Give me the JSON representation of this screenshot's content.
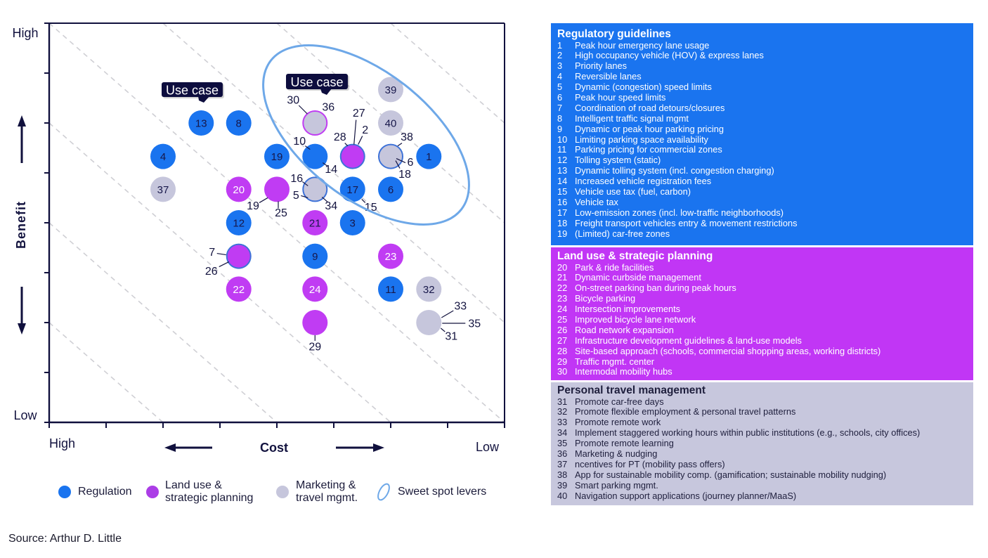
{
  "colors": {
    "regulation": "#1a74ef",
    "land_use": "#c03cf3",
    "marketing": "#c6c6dc",
    "sweet_spot": "#6ea8e8",
    "ink": "#13133f",
    "callout": "#0d0d3e"
  },
  "chart_data": {
    "type": "scatter",
    "title": "",
    "xlabel": "Cost",
    "ylabel": "Benefit",
    "x_end_labels": {
      "left": "High",
      "right": "Low"
    },
    "y_end_labels": {
      "top": "High",
      "bottom": "Low"
    },
    "xlim": [
      0,
      8
    ],
    "ylim": [
      0,
      8
    ],
    "x_ticks": 8,
    "y_ticks": 8,
    "grid": "diagonal dashed iso-lines (cost + benefit = constant)",
    "legend_position": "bottom",
    "points": [
      {
        "id": "13",
        "label": "13",
        "x": 2.67,
        "y": 6.0,
        "fill": "regulation",
        "text": "dark",
        "outer_labels": []
      },
      {
        "id": "8",
        "label": "8",
        "x": 3.33,
        "y": 6.0,
        "fill": "regulation",
        "text": "dark",
        "outer_labels": []
      },
      {
        "id": "4",
        "label": "4",
        "x": 2.0,
        "y": 5.33,
        "fill": "regulation",
        "text": "dark",
        "outer_labels": []
      },
      {
        "id": "37",
        "label": "37",
        "x": 2.0,
        "y": 4.67,
        "fill": "marketing",
        "text": "dark",
        "outer_labels": []
      },
      {
        "id": "20",
        "label": "20",
        "x": 3.33,
        "y": 4.67,
        "fill": "land_use",
        "text": "light",
        "outer_labels": []
      },
      {
        "id": "12",
        "label": "12",
        "x": 3.33,
        "y": 4.0,
        "fill": "regulation",
        "text": "dark",
        "outer_labels": []
      },
      {
        "id": "7/26",
        "label": "",
        "x": 3.33,
        "y": 3.33,
        "fill": "land_use",
        "outline": "regulation",
        "text": "dark",
        "outer_labels": [
          "7",
          "26"
        ]
      },
      {
        "id": "22",
        "label": "22",
        "x": 3.33,
        "y": 2.67,
        "fill": "land_use",
        "text": "light",
        "outer_labels": []
      },
      {
        "id": "19",
        "label": "19",
        "x": 4.0,
        "y": 5.33,
        "fill": "regulation",
        "text": "dark",
        "outer_labels": []
      },
      {
        "id": "19/25",
        "label": "",
        "x": 4.0,
        "y": 4.67,
        "fill": "land_use",
        "text": "dark",
        "outer_labels": [
          "19",
          "25"
        ]
      },
      {
        "id": "30/36",
        "label": "",
        "x": 4.67,
        "y": 6.0,
        "fill": "marketing",
        "outline": "land_use",
        "text": "dark",
        "outer_labels": [
          "30",
          "36"
        ]
      },
      {
        "id": "10/14",
        "label": "",
        "x": 4.67,
        "y": 5.33,
        "fill": "regulation",
        "text": "dark",
        "outer_labels": [
          "10",
          "14"
        ]
      },
      {
        "id": "16/5/34",
        "label": "",
        "x": 4.67,
        "y": 4.67,
        "fill": "marketing",
        "outline": "regulation",
        "text": "dark",
        "outer_labels": [
          "16",
          "5",
          "34"
        ]
      },
      {
        "id": "21",
        "label": "21",
        "x": 4.67,
        "y": 4.0,
        "fill": "land_use",
        "text": "dark",
        "outer_labels": []
      },
      {
        "id": "9",
        "label": "9",
        "x": 4.67,
        "y": 3.33,
        "fill": "regulation",
        "text": "dark",
        "outer_labels": []
      },
      {
        "id": "24",
        "label": "24",
        "x": 4.67,
        "y": 2.67,
        "fill": "land_use",
        "text": "light",
        "outer_labels": []
      },
      {
        "id": "29",
        "label": "",
        "x": 4.67,
        "y": 2.0,
        "fill": "land_use",
        "text": "dark",
        "outer_labels": [
          "29"
        ]
      },
      {
        "id": "28/27/2",
        "label": "",
        "x": 5.33,
        "y": 5.33,
        "fill": "land_use",
        "outline": "regulation",
        "text": "dark",
        "outer_labels": [
          "28",
          "27",
          "2"
        ]
      },
      {
        "id": "17",
        "label": "17",
        "x": 5.33,
        "y": 4.67,
        "fill": "regulation",
        "text": "dark",
        "outer_labels": [
          "15"
        ]
      },
      {
        "id": "3",
        "label": "3",
        "x": 5.33,
        "y": 4.0,
        "fill": "regulation",
        "text": "dark",
        "outer_labels": []
      },
      {
        "id": "39",
        "label": "39",
        "x": 6.0,
        "y": 6.67,
        "fill": "marketing",
        "text": "dark",
        "outer_labels": []
      },
      {
        "id": "40",
        "label": "40",
        "x": 6.0,
        "y": 6.0,
        "fill": "marketing",
        "text": "dark",
        "outer_labels": []
      },
      {
        "id": "38/6/18",
        "label": "",
        "x": 6.0,
        "y": 5.33,
        "fill": "marketing",
        "outline": "regulation",
        "text": "dark",
        "outer_labels": [
          "38",
          "6",
          "18"
        ]
      },
      {
        "id": "6",
        "label": "6",
        "x": 6.0,
        "y": 4.67,
        "fill": "regulation",
        "text": "dark",
        "outer_labels": []
      },
      {
        "id": "23",
        "label": "23",
        "x": 6.0,
        "y": 3.33,
        "fill": "land_use",
        "text": "light",
        "outer_labels": []
      },
      {
        "id": "11",
        "label": "11",
        "x": 6.0,
        "y": 2.67,
        "fill": "regulation",
        "text": "dark",
        "outer_labels": []
      },
      {
        "id": "1",
        "label": "1",
        "x": 6.67,
        "y": 5.33,
        "fill": "regulation",
        "text": "dark",
        "outer_labels": []
      },
      {
        "id": "32",
        "label": "32",
        "x": 6.67,
        "y": 2.67,
        "fill": "marketing",
        "text": "dark",
        "outer_labels": []
      },
      {
        "id": "33/35/31",
        "label": "",
        "x": 6.67,
        "y": 2.0,
        "fill": "marketing",
        "text": "dark",
        "outer_labels": [
          "33",
          "35",
          "31"
        ]
      }
    ],
    "callouts": [
      {
        "text": "Use case",
        "points_to": "13"
      },
      {
        "text": "Use case",
        "points_to": "30/36"
      }
    ],
    "sweet_spot": {
      "label": "Sweet spot levers",
      "members": [
        "39",
        "40",
        "30/36",
        "10/14",
        "28/27/2",
        "38/6/18",
        "1",
        "17",
        "6",
        "16/5/34"
      ]
    }
  },
  "legend": {
    "items": [
      {
        "key": "regulation",
        "line1": "Regulation",
        "line2": ""
      },
      {
        "key": "land_use",
        "line1": "Land use &",
        "line2": "strategic planning"
      },
      {
        "key": "marketing",
        "line1": "Marketing &",
        "line2": "travel mgmt."
      },
      {
        "key": "sweet_spot",
        "line1": "Sweet spot levers",
        "line2": ""
      }
    ]
  },
  "panels": [
    {
      "title": "Regulatory guidelines",
      "items": [
        {
          "n": "1",
          "text": "Peak hour emergency lane usage"
        },
        {
          "n": "2",
          "text": "High occupancy vehicle (HOV) & express lanes"
        },
        {
          "n": "3",
          "text": "Priority lanes"
        },
        {
          "n": "4",
          "text": "Reversible lanes"
        },
        {
          "n": "5",
          "text": "Dynamic (congestion) speed limits"
        },
        {
          "n": "6",
          "text": "Peak hour speed limits"
        },
        {
          "n": "7",
          "text": "Coordination of road detours/closures"
        },
        {
          "n": "8",
          "text": "Intelligent traffic signal mgmt"
        },
        {
          "n": "9",
          "text": "Dynamic or peak hour parking pricing"
        },
        {
          "n": "10",
          "text": "Limiting parking space availability"
        },
        {
          "n": "11",
          "text": "Parking pricing for commercial zones"
        },
        {
          "n": "12",
          "text": "Tolling system (static)"
        },
        {
          "n": "13",
          "text": "Dynamic tolling system (incl. congestion charging)"
        },
        {
          "n": "14",
          "text": "Increased vehicle registration fees"
        },
        {
          "n": "15",
          "text": "Vehicle use tax (fuel, carbon)"
        },
        {
          "n": "16",
          "text": "Vehicle tax"
        },
        {
          "n": "17",
          "text": "Low-emission zones (incl. low-traffic neighborhoods)"
        },
        {
          "n": "18",
          "text": "Freight transport vehicles entry & movement restrictions"
        },
        {
          "n": "19",
          "text": "(Limited) car-free zones"
        }
      ]
    },
    {
      "title": "Land use & strategic planning",
      "items": [
        {
          "n": "20",
          "text": "Park & ride facilities"
        },
        {
          "n": "21",
          "text": "Dynamic curbside management"
        },
        {
          "n": "22",
          "text": "On-street parking ban during peak hours"
        },
        {
          "n": "23",
          "text": "Bicycle parking"
        },
        {
          "n": "24",
          "text": "Intersection improvements"
        },
        {
          "n": "25",
          "text": "Improved bicycle lane network"
        },
        {
          "n": "26",
          "text": "Road network expansion"
        },
        {
          "n": "27",
          "text": "Infrastructure development guidelines & land-use models"
        },
        {
          "n": "28",
          "text": "Site-based approach (schools, commercial shopping areas, working districts)"
        },
        {
          "n": "29",
          "text": "Traffic mgmt. center"
        },
        {
          "n": "30",
          "text": "Intermodal mobility hubs"
        }
      ]
    },
    {
      "title": "Personal travel management",
      "items": [
        {
          "n": "31",
          "text": "Promote car-free days"
        },
        {
          "n": "32",
          "text": "Promote flexible employment & personal travel patterns"
        },
        {
          "n": "33",
          "text": "Promote remote work"
        },
        {
          "n": "34",
          "text": "Implement staggered working hours within public institutions (e.g., schools, city offices)"
        },
        {
          "n": "35",
          "text": "Promote remote learning"
        },
        {
          "n": "36",
          "text": "Marketing & nudging"
        },
        {
          "n": "37",
          "text": "ncentives for PT (mobility pass offers)"
        },
        {
          "n": "38",
          "text": "App for sustainable mobility comp. (gamification; sustainable mobility nudging)"
        },
        {
          "n": "39",
          "text": "Smart parking mgmt."
        },
        {
          "n": "40",
          "text": "Navigation support applications (journey planner/MaaS)"
        }
      ]
    }
  ],
  "source": "Source: Arthur D. Little"
}
